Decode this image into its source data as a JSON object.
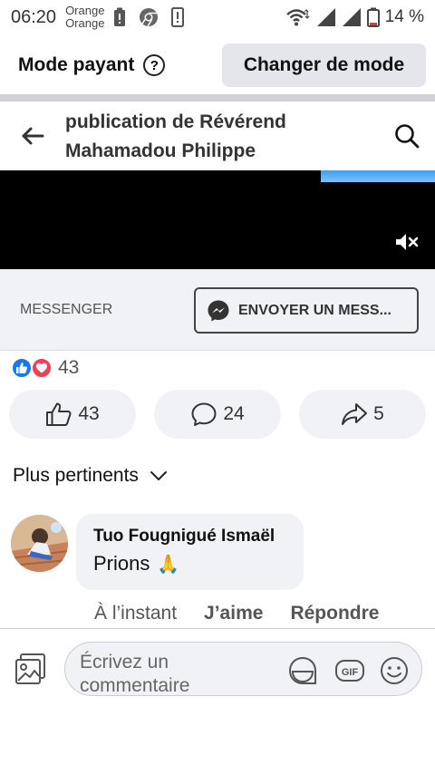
{
  "status_bar": {
    "time": "06:20",
    "carrier_1": "Orange",
    "carrier_2": "Orange",
    "battery": "14 %"
  },
  "mode_bar": {
    "label": "Mode payant",
    "help_icon": "?",
    "button": "Changer de mode"
  },
  "header": {
    "title_line_1": "publication de Révérend",
    "title_line_2": "Mahamadou Philippe"
  },
  "messenger": {
    "label": "MESSENGER",
    "button": "ENVOYER UN MESS..."
  },
  "reactions": {
    "count": "43",
    "like_count": "43",
    "comment_count": "24",
    "share_count": "5"
  },
  "sort": {
    "label": "Plus pertinents"
  },
  "comment": {
    "author": "Tuo Fougnigué Ismaël",
    "text": "Prions",
    "emoji": "🙏",
    "time": "À l’instant",
    "like": "J’aime",
    "reply": "Répondre"
  },
  "composer": {
    "placeholder": "Écrivez un commentaire",
    "gif_label": "GIF"
  },
  "colors": {
    "accent": "#1877f2",
    "love": "#f33e58",
    "bubble": "#f0f2f5",
    "video_progress": "#3fa0ee"
  },
  "icons": [
    "battery-icon",
    "chrome-icon",
    "sim-icon",
    "wifi-icon",
    "signal-icon",
    "help-icon",
    "back-arrow-icon",
    "search-icon",
    "mute-icon",
    "messenger-icon",
    "like-icon",
    "love-icon",
    "thumb-up-icon",
    "comment-icon",
    "share-icon",
    "chevron-down-icon",
    "photo-icon",
    "sticker-icon",
    "gif-icon",
    "emoji-icon"
  ]
}
